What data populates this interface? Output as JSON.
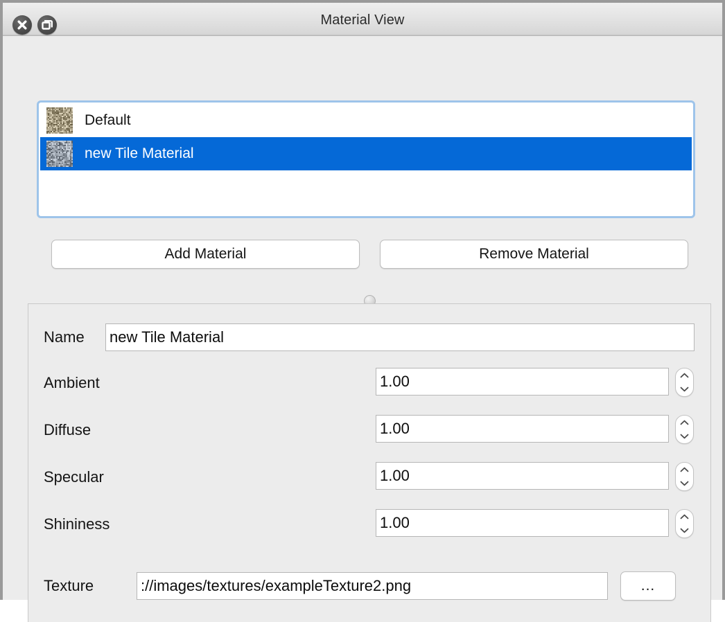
{
  "window": {
    "title": "Material View",
    "buttons": [
      {
        "name": "close-button",
        "icon": "close-icon"
      },
      {
        "name": "restore-button",
        "icon": "restore-window-icon"
      }
    ]
  },
  "material_list": {
    "items": [
      {
        "label": "Default",
        "selected": false,
        "thumbnail": "noise-texture-thumbnail"
      },
      {
        "label": "new Tile Material",
        "selected": true,
        "thumbnail": "noise-texture-thumbnail"
      }
    ],
    "selection_color": "#0569d7",
    "focus_ring_color": "#9ec4ea"
  },
  "actions": {
    "add_label": "Add Material",
    "remove_label": "Remove Material"
  },
  "details": {
    "name": {
      "label": "Name",
      "value": "new Tile Material"
    },
    "ambient": {
      "label": "Ambient",
      "value": "1.00"
    },
    "diffuse": {
      "label": "Diffuse",
      "value": "1.00"
    },
    "specular": {
      "label": "Specular",
      "value": "1.00"
    },
    "shininess": {
      "label": "Shininess",
      "value": "1.00"
    },
    "texture": {
      "label": "Texture",
      "value": "://images/textures/exampleTexture2.png",
      "browse_label": "..."
    }
  }
}
